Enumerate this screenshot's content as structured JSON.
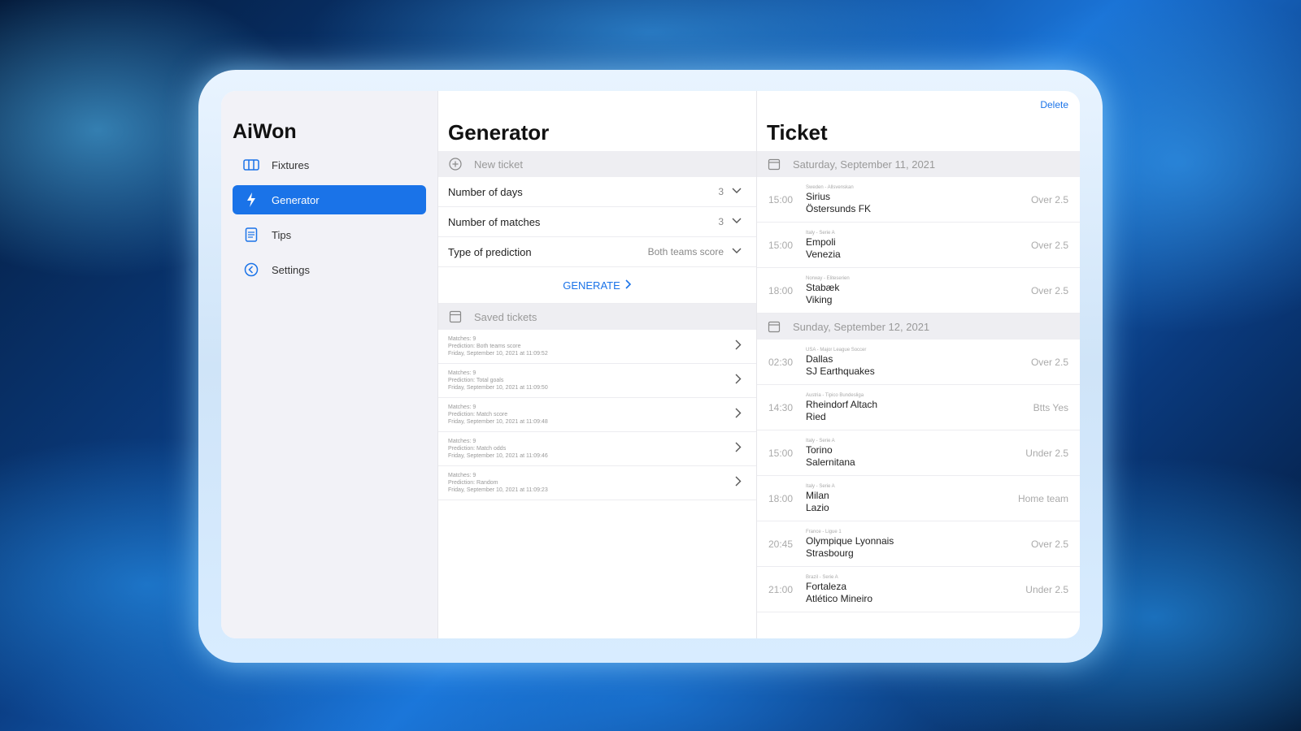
{
  "app": {
    "title": "AiWon"
  },
  "sidebar": {
    "items": [
      {
        "label": "Fixtures",
        "icon": "fixtures-icon"
      },
      {
        "label": "Generator",
        "icon": "lightning-icon"
      },
      {
        "label": "Tips",
        "icon": "tips-icon"
      },
      {
        "label": "Settings",
        "icon": "settings-icon"
      }
    ]
  },
  "generator": {
    "title": "Generator",
    "new_ticket": "New ticket",
    "fields": [
      {
        "label": "Number of days",
        "value": "3"
      },
      {
        "label": "Number of matches",
        "value": "3"
      },
      {
        "label": "Type of prediction",
        "value": "Both teams score"
      }
    ],
    "generate_label": "GENERATE",
    "saved_tickets": "Saved tickets",
    "saved": [
      {
        "line1": "Matches: 9",
        "line2": "Prediction: Both teams score",
        "line3": "Friday, September 10, 2021 at 11:09:52"
      },
      {
        "line1": "Matches: 9",
        "line2": "Prediction: Total goals",
        "line3": "Friday, September 10, 2021 at 11:09:50"
      },
      {
        "line1": "Matches: 9",
        "line2": "Prediction: Match score",
        "line3": "Friday, September 10, 2021 at 11:09:48"
      },
      {
        "line1": "Matches: 9",
        "line2": "Prediction: Match odds",
        "line3": "Friday, September 10, 2021 at 11:09:46"
      },
      {
        "line1": "Matches: 9",
        "line2": "Prediction: Random",
        "line3": "Friday, September 10, 2021 at 11:09:23"
      }
    ]
  },
  "ticket": {
    "title": "Ticket",
    "delete_label": "Delete",
    "days": [
      {
        "date": "Saturday, September 11, 2021",
        "matches": [
          {
            "time": "15:00",
            "league": "Sweden - Allsvenskan",
            "home": "Sirius",
            "away": "Östersunds FK",
            "pred": "Over 2.5"
          },
          {
            "time": "15:00",
            "league": "Italy - Serie A",
            "home": "Empoli",
            "away": "Venezia",
            "pred": "Over 2.5"
          },
          {
            "time": "18:00",
            "league": "Norway - Eliteserien",
            "home": "Stabæk",
            "away": "Viking",
            "pred": "Over 2.5"
          }
        ]
      },
      {
        "date": "Sunday, September 12, 2021",
        "matches": [
          {
            "time": "02:30",
            "league": "USA - Major League Soccer",
            "home": "Dallas",
            "away": "SJ Earthquakes",
            "pred": "Over 2.5"
          },
          {
            "time": "14:30",
            "league": "Austria - Tipico Bundesliga",
            "home": "Rheindorf Altach",
            "away": "Ried",
            "pred": "Btts Yes"
          },
          {
            "time": "15:00",
            "league": "Italy - Serie A",
            "home": "Torino",
            "away": "Salernitana",
            "pred": "Under 2.5"
          },
          {
            "time": "18:00",
            "league": "Italy - Serie A",
            "home": "Milan",
            "away": "Lazio",
            "pred": "Home team"
          },
          {
            "time": "20:45",
            "league": "France - Ligue 1",
            "home": "Olympique Lyonnais",
            "away": "Strasbourg",
            "pred": "Over 2.5"
          },
          {
            "time": "21:00",
            "league": "Brazil - Serie A",
            "home": "Fortaleza",
            "away": "Atlético Mineiro",
            "pred": "Under 2.5"
          }
        ]
      }
    ]
  },
  "colors": {
    "accent": "#1a73e8",
    "sidebar_bg": "#f2f2f7"
  }
}
